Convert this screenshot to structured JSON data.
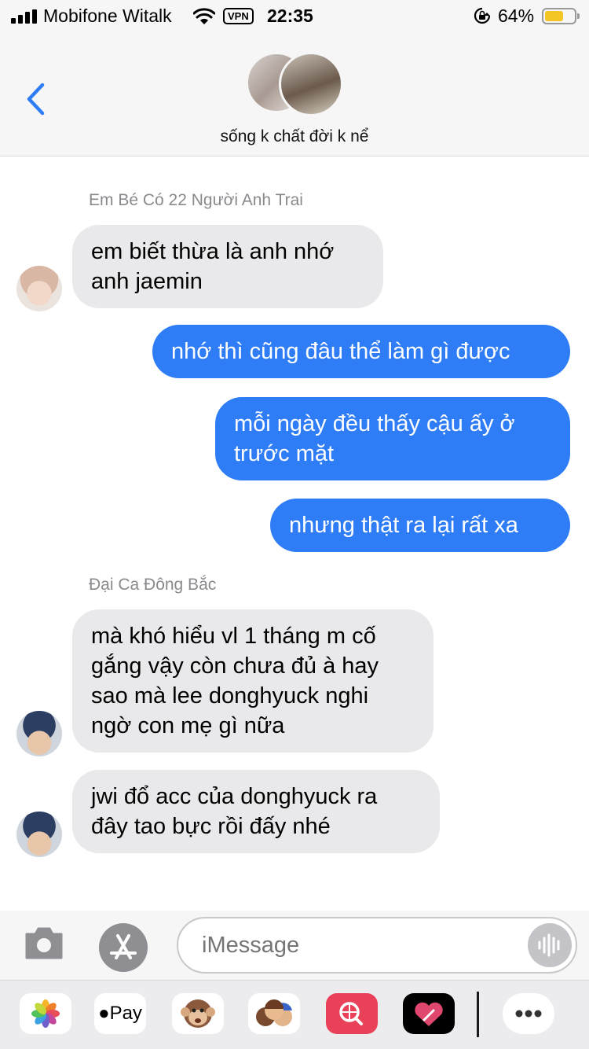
{
  "status_bar": {
    "carrier": "Mobifone Witalk",
    "vpn": "VPN",
    "time": "22:35",
    "battery": "64%",
    "battery_level": 0.64,
    "battery_color": "#f3c626"
  },
  "header": {
    "back_icon": "chevron-left-icon",
    "group_name": "sống k chất đời k nể"
  },
  "messages": [
    {
      "sender": "Em Bé Có 22 Người Anh Trai",
      "direction": "incoming",
      "text": "em biết thừa là anh nhớ\nanh jaemin"
    },
    {
      "direction": "outgoing",
      "text": "nhớ thì cũng đâu thể làm gì được"
    },
    {
      "direction": "outgoing",
      "text": "mỗi ngày đều thấy cậu ấy ở\ntrước mặt"
    },
    {
      "direction": "outgoing",
      "text": "nhưng thật ra lại rất xa"
    },
    {
      "sender": "Đại Ca Đông Bắc",
      "direction": "incoming",
      "text": "mà khó hiểu vl 1 tháng m cố\ngắng vậy còn chưa đủ à hay\nsao mà lee donghyuck nghi\nngờ con mẹ gì nữa"
    },
    {
      "direction": "incoming",
      "text": "jwi đổ acc của donghyuck ra\nđây tao bực rồi đấy nhé"
    }
  ],
  "compose": {
    "placeholder": "iMessage"
  },
  "app_drawer": {
    "apple_pay_label": "Pay",
    "icons": [
      "photos-icon",
      "apple-pay-icon",
      "animoji-icon",
      "memoji-icon",
      "web-search-icon",
      "digital-touch-icon",
      "more-icon"
    ]
  },
  "colors": {
    "outgoing_bubble": "#2f7df6",
    "incoming_bubble": "#e9e9eb",
    "accent": "#2f7df6"
  }
}
